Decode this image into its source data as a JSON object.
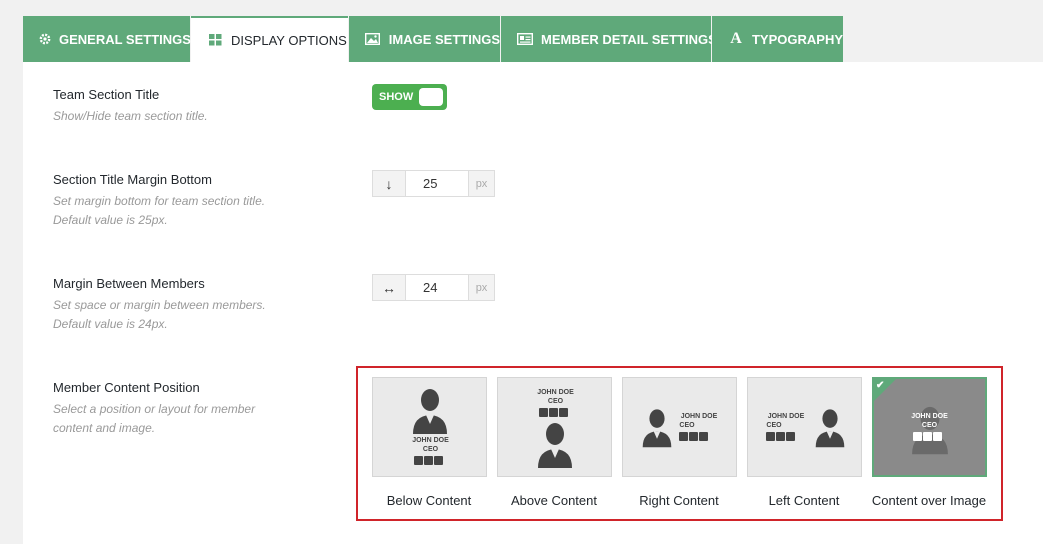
{
  "tabs": [
    {
      "label": "General Settings",
      "icon": "gear-icon"
    },
    {
      "label": "Display Options",
      "icon": "grid-icon"
    },
    {
      "label": "Image Settings",
      "icon": "image-icon"
    },
    {
      "label": "Member Detail Settings",
      "icon": "id-card-icon"
    },
    {
      "label": "Typography",
      "icon": "font-icon"
    }
  ],
  "rows": {
    "team_title": {
      "label": "Team Section Title",
      "desc": "Show/Hide team section title.",
      "toggle": "SHOW"
    },
    "margin_bottom": {
      "label": "Section Title Margin Bottom",
      "desc1": "Set margin bottom for team section title.",
      "desc2": "Default value is 25px.",
      "value": "25",
      "unit": "px",
      "icon": "↓"
    },
    "margin_members": {
      "label": "Margin Between Members",
      "desc1": "Set space or margin between members.",
      "desc2": "Default value is 24px.",
      "value": "24",
      "unit": "px",
      "icon": "↔"
    },
    "content_position": {
      "label": "Member Content Position",
      "desc1": "Select a position or layout for member",
      "desc2": "content and image."
    }
  },
  "layouts": [
    {
      "label": "Below Content",
      "name": "JOHN DOE",
      "role": "CEO"
    },
    {
      "label": "Above Content",
      "name": "JOHN DOE",
      "role": "CEO"
    },
    {
      "label": "Right Content",
      "name": "JOHN DOE",
      "role": "CEO"
    },
    {
      "label": "Left Content",
      "name": "JOHN DOE",
      "role": "CEO"
    },
    {
      "label": "Content over Image",
      "name": "JOHN DOE",
      "role": "CEO",
      "selected": true
    }
  ],
  "colors": {
    "accent": "#5fa97a",
    "toggle_on": "#4caf50",
    "highlight": "#d0242a"
  }
}
